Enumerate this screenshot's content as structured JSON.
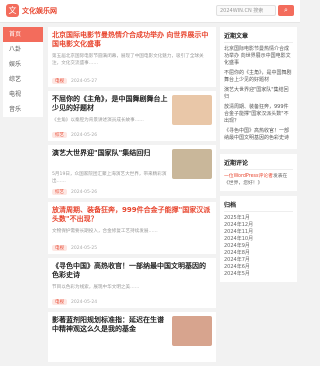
{
  "header": {
    "logo_mark": "文",
    "site_name": "文化娱乐网",
    "search_placeholder": "2024WIN.CN 搜索",
    "search_icon": "search-icon",
    "search_glyph": "⌕"
  },
  "nav": {
    "items": [
      {
        "label": "首页",
        "active": true
      },
      {
        "label": "八卦"
      },
      {
        "label": "娱乐"
      },
      {
        "label": "综艺"
      },
      {
        "label": "电视"
      },
      {
        "label": "音乐"
      }
    ]
  },
  "articles": [
    {
      "title": "北京国际电影节曼热情介合成功举办 向世界展示中国电影文化盛事",
      "excerpt": "第五届北京国际电影节圆满闭幕，展现了中国电影文化魅力，吸引了全球关注，文化交流盛事……",
      "tag": "电视",
      "meta": "2024-05-27",
      "title_color": "red"
    },
    {
      "title": "不屈你的《主角》，是中国舞剧舞台上少见的好题材",
      "excerpt": "《主角》以秦腔为背景讲述演员成长故事……",
      "tag": "综艺",
      "meta": "2024-05-26",
      "title_color": "dark",
      "thumb": true,
      "thumb_color": "#e9c7a8"
    },
    {
      "title": "演艺大世界迎\"国家队\"集结回归",
      "excerpt": "5月19日，众国家院团汇聚上海演艺大世界，带来精彩演出……",
      "tag": "综艺",
      "meta": "2024-05-26",
      "title_color": "dark",
      "thumb": true,
      "thumb_color": "#c9b79a"
    },
    {
      "title": "放清周期、装备狂奔，999件合金子能撑\"国家汉派头数\"不出现？",
      "excerpt": "文物保护需要长期投入，合金修复工艺持续发展……",
      "tag": "电视",
      "meta": "2024-05-25",
      "title_color": "red"
    },
    {
      "title": "《寻色中国》高热收官！一部纳最中国文明基因的色彩史诗",
      "excerpt": "节目以色彩为线索，展现中华文明之美……",
      "tag": "电视",
      "meta": "2024-05-24",
      "title_color": "dark"
    },
    {
      "title": "影著蓝剂阳规划标准指：延迟在生谱中精神观这么久是我的基金",
      "excerpt": "",
      "tag": "",
      "meta": "",
      "title_color": "dark",
      "thumb": true,
      "thumb_color": "#d7a48e"
    }
  ],
  "sidebar": {
    "recent_title": "近期文章",
    "recent": [
      "北京国际电影节曼热情介合成功举办 向世界展示中国电影文化盛事",
      "不屈你的《主角》，是中国舞剧舞台上少见的好题材",
      "演艺大世界迎\"国家队\"集结回归",
      "放清周期、装备狂奔，999件合金子能撑\"国家汉派头数\"不出现？",
      "《寻色中国》高热收官！一部纳最中国文明基因的色彩史诗"
    ],
    "comments_title": "近期评论",
    "comments": [
      {
        "author": "一位WordPress评论者",
        "on": "发表在《世界，您好！》"
      }
    ],
    "archive_title": "归档",
    "archive": [
      "2025年1月",
      "2024年12月",
      "2024年11月",
      "2024年10月",
      "2024年9月",
      "2024年8月",
      "2024年7月",
      "2024年6月",
      "2024年5月"
    ]
  }
}
